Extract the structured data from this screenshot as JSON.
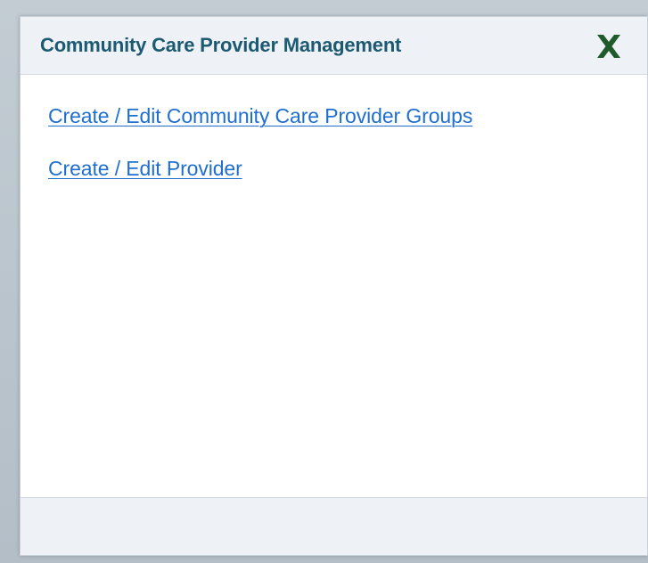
{
  "dialog": {
    "title": "Community Care Provider Management",
    "close_icon": "close-x-icon",
    "links": [
      {
        "label": "Create / Edit Community Care Provider Groups"
      },
      {
        "label": "Create / Edit Provider"
      }
    ]
  },
  "colors": {
    "title": "#1c5a72",
    "close_icon": "#1e5a2a",
    "link": "#1f6fd1",
    "header_bg": "#eef1f5",
    "footer_bg": "#eef1f5",
    "backdrop": "#b7c1c9"
  }
}
